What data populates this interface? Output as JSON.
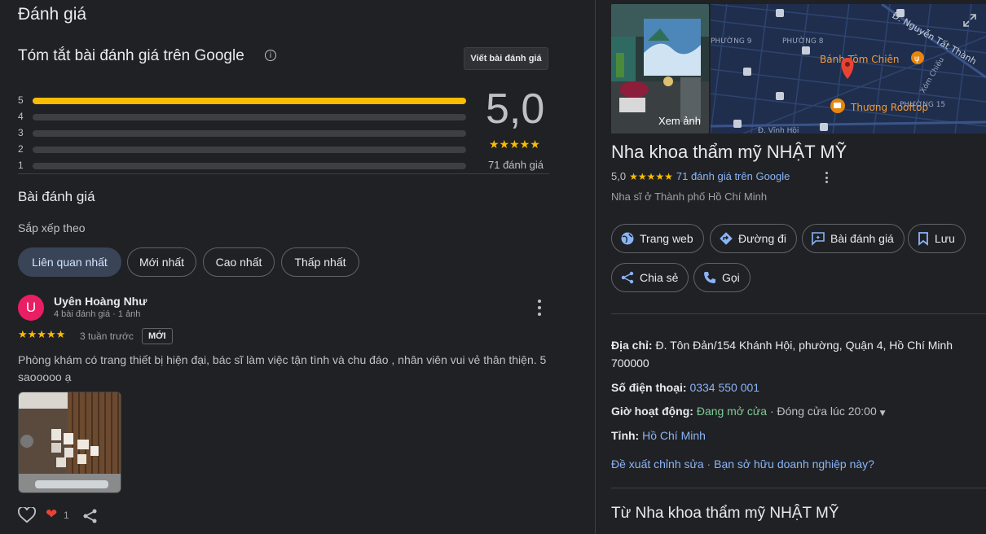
{
  "reviews_panel": {
    "title": "Đánh giá",
    "summary_title": "Tóm tắt bài đánh giá trên Google",
    "info_icon": "info-icon",
    "write_review_label": "Viết bài đánh giá",
    "distribution": [
      {
        "stars": "5",
        "fraction": 1.0
      },
      {
        "stars": "4",
        "fraction": 0.0
      },
      {
        "stars": "3",
        "fraction": 0.0
      },
      {
        "stars": "2",
        "fraction": 0.0
      },
      {
        "stars": "1",
        "fraction": 0.0
      }
    ],
    "score": "5,0",
    "score_stars": "★★★★★",
    "review_count": "71 đánh giá",
    "section_title": "Bài đánh giá",
    "sort_label": "Sắp xếp theo",
    "sort_options": [
      "Liên quan nhất",
      "Mới nhất",
      "Cao nhất",
      "Thấp nhất"
    ],
    "review": {
      "avatar_letter": "U",
      "avatar_color": "#e91e63",
      "author": "Uyên Hoàng Như",
      "meta": "4 bài đánh giá · 1 ảnh",
      "stars": "★★★★★",
      "time": "3 tuần trước",
      "badge": "MỚI",
      "text": "Phòng khám có trang thiết bị hiện đại, bác sĩ làm việc tận tình và chu đáo , nhân viên vui vẻ thân thiện. 5 saooooo ạ",
      "reaction_emoji": "❤",
      "reaction_count": "1"
    }
  },
  "place": {
    "photo_label": "Xem ảnh",
    "map_labels": {
      "street_1": "Đ. Nguyễn Tất Thành",
      "ward_9": "PHƯỜNG 9",
      "ward_8": "PHƯỜNG 8",
      "poi_1": "Bánh Tôm Chiên",
      "poi_2": "Thương Rooftop",
      "ward_15": "PHƯỜNG 15",
      "street_2": "Xóm Chiếu",
      "street_3": "Đ. Vĩnh Hội"
    },
    "name": "Nha khoa thẩm mỹ NHẬT MỸ",
    "rating": "5,0",
    "rating_stars": "★★★★★",
    "rating_link": "71 đánh giá trên Google",
    "category": "Nha sĩ ở Thành phố Hồ Chí Minh",
    "actions": {
      "website": "Trang web",
      "directions": "Đường đi",
      "reviews": "Bài đánh giá",
      "save": "Lưu",
      "share": "Chia sẻ",
      "call": "Gọi"
    },
    "address_label": "Địa chỉ:",
    "address": "Đ. Tôn Đản/154 Khánh Hội, phường, Quận 4, Hồ Chí Minh 700000",
    "phone_label": "Số điện thoại:",
    "phone": "0334 550 001",
    "hours_label": "Giờ hoạt động:",
    "hours_status": "Đang mở cửa",
    "hours_close": "· Đóng cửa lúc 20:00",
    "province_label": "Tỉnh:",
    "province": "Hồ Chí Minh",
    "suggest_edit": "Đề xuất chỉnh sửa",
    "own_business": "Bạn sở hữu doanh nghiệp này?",
    "link_separator": "·",
    "from_title": "Từ Nha khoa thẩm mỹ NHẬT MỸ"
  },
  "colors": {
    "background": "#202124",
    "star": "#fbbc04",
    "link": "#8ab4f8",
    "open": "#81c995",
    "active_chip": "#394457"
  }
}
